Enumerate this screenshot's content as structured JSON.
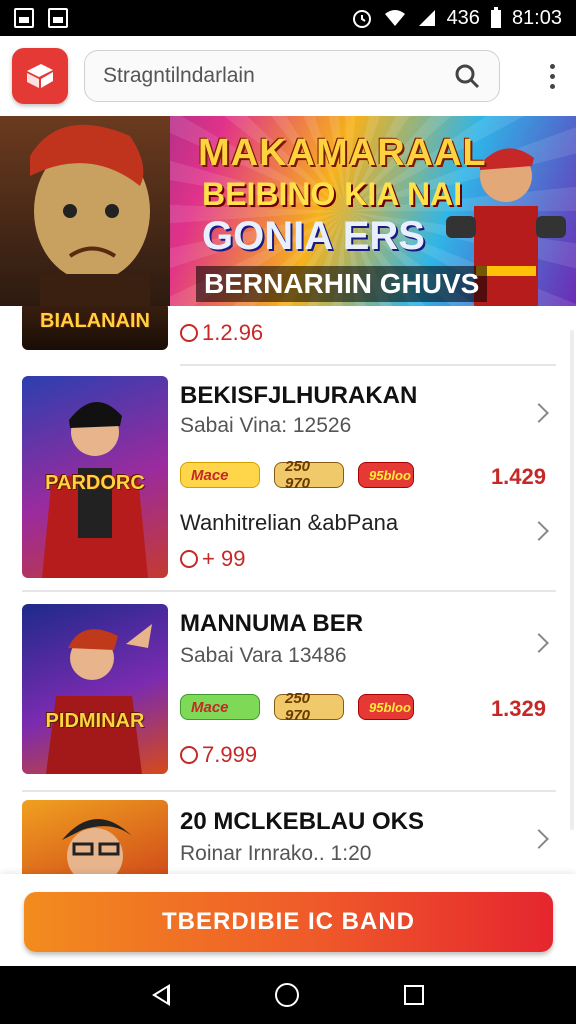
{
  "status_bar": {
    "battery_text": "436",
    "time": "81:03"
  },
  "app_bar": {
    "search_placeholder": "Stragntilndarlain",
    "icons": {
      "logo": "shopping-bag-icon",
      "search": "search-icon",
      "menu": "more-vert-icon"
    }
  },
  "banner": {
    "title": "MAKAMARAAL",
    "line2": "BEIBINO KIA NAI",
    "line3": "GONIA ERS",
    "line4": "BERNARHIN GHUVS",
    "left_label": "BIALANAIN"
  },
  "list": {
    "items": [
      {
        "rating_text": "1.2.96"
      },
      {
        "thumb_label": "PARDORC",
        "title": "BEKISFJLHURAKAN",
        "subtitle": "Sabai Vina: 12526",
        "badges": [
          "Mace",
          "250 970",
          "95bloo"
        ],
        "price": "1.429",
        "note": "Wanhitrelian &abPana",
        "rating_text": "+ 99"
      },
      {
        "thumb_label": "PIDMINAR",
        "title": "MANNUMA BER",
        "subtitle": "Sabai Vara 13486",
        "badges": [
          "Mace",
          "250 970",
          "95bloo"
        ],
        "price": "1.329",
        "rating_text": "7.999"
      },
      {
        "title": "20 MCLKEBLAU OKS",
        "subtitle": "Roinar Irnrako.. 1:20"
      }
    ]
  },
  "cta": {
    "label": "TBERDIBIE IC BAND"
  },
  "colors": {
    "accent_red": "#e53935",
    "price_red": "#c62828",
    "cta_start": "#f28c1e",
    "cta_end": "#e5262e"
  }
}
